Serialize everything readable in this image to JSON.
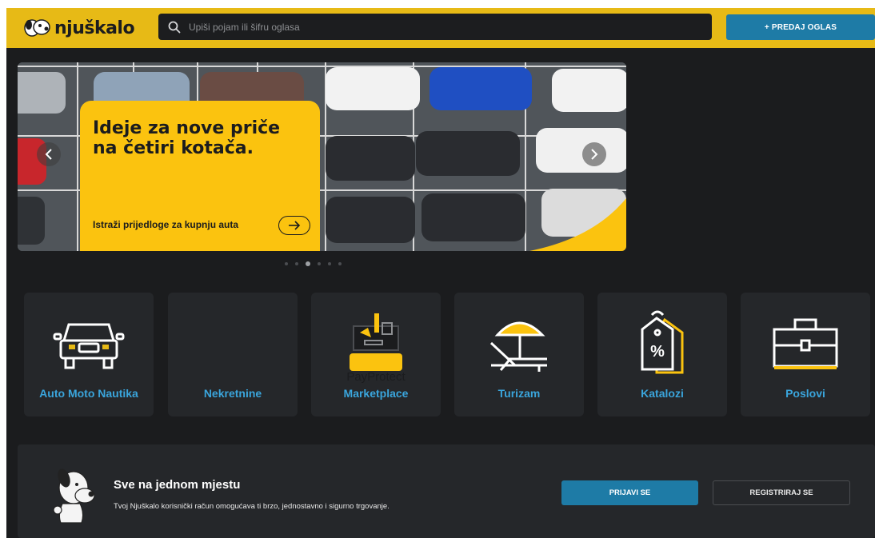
{
  "header": {
    "logo_text": "njuškalo",
    "search_placeholder": "Upiši pojam ili šifru oglasa",
    "sell_button": "+ PREDAJ OGLAS"
  },
  "banner": {
    "title": "Ideje za nove priče na četiri kotača.",
    "cta": "Istraži prijedloge za kupnju auta",
    "dots_total": 6,
    "active_dot": 3
  },
  "categories": [
    {
      "label": "Auto Moto Nautika",
      "icon": "car-icon"
    },
    {
      "label": "Nekretnine",
      "icon": "none"
    },
    {
      "label": "Marketplace",
      "icon": "marketplace-icon",
      "badge": "PayProtect"
    },
    {
      "label": "Turizam",
      "icon": "beach-umbrella-icon"
    },
    {
      "label": "Katalozi",
      "icon": "discount-tag-icon"
    },
    {
      "label": "Poslovi",
      "icon": "briefcase-icon"
    }
  ],
  "account": {
    "title": "Sve na jednom mjestu",
    "text": "Tvoj Njuškalo korisnički račun omogućava ti brzo, jednostavno i sigurno trgovanje.",
    "login_button": "PRIJAVI SE",
    "register_button": "REGISTRIRAJ SE"
  },
  "colors": {
    "brand_yellow": "#e7ba16",
    "banner_yellow": "#fbc30f",
    "accent_blue": "#1e7ba6",
    "link_blue": "#3aa5dc",
    "background": "#1b1c1e",
    "card": "#25272a"
  }
}
